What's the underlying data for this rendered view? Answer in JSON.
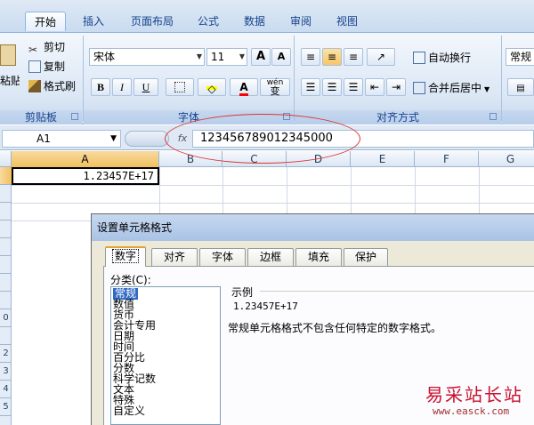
{
  "ribbon": {
    "tabs": [
      "开始",
      "插入",
      "页面布局",
      "公式",
      "数据",
      "审阅",
      "视图"
    ],
    "active_tab": "开始",
    "clipboard": {
      "paste": "粘贴",
      "cut": "剪切",
      "copy": "复制",
      "format_painter": "格式刷",
      "group": "剪贴板"
    },
    "font": {
      "name": "宋体",
      "size": "11",
      "grow": "A",
      "shrink": "A",
      "bold": "B",
      "italic": "I",
      "underline": "U",
      "font_color_letter": "A",
      "phonetic": "wén",
      "phonetic_char": "变",
      "group": "字体"
    },
    "alignment": {
      "wrap": "自动换行",
      "merge": "合并后居中",
      "group": "对齐方式"
    },
    "number": {
      "format": "常规"
    }
  },
  "formula_bar": {
    "name_box": "A1",
    "fx": "fx",
    "value": "123456789012345000"
  },
  "sheet": {
    "columns": [
      "A",
      "B",
      "C",
      "D",
      "E",
      "F",
      "G"
    ],
    "rows": [
      "",
      "",
      "",
      "",
      "",
      "",
      "",
      "",
      "0",
      "",
      "2",
      "3",
      "4",
      "5"
    ],
    "a1_display": "1.23457E+17"
  },
  "dialog": {
    "title": "设置单元格格式",
    "tabs": [
      "数字",
      "对齐",
      "字体",
      "边框",
      "填充",
      "保护"
    ],
    "active_tab": "数字",
    "category_label": "分类(C):",
    "categories": [
      "常规",
      "数值",
      "货币",
      "会计专用",
      "日期",
      "时间",
      "百分比",
      "分数",
      "科学记数",
      "文本",
      "特殊",
      "自定义"
    ],
    "selected_category": "常规",
    "sample_label": "示例",
    "sample_value": "1.23457E+17",
    "description": "常规单元格格式不包含任何特定的数字格式。"
  },
  "watermark": {
    "brand": "易采站长站",
    "url": "www.easck.com"
  },
  "colors": {
    "ribbon_blue": "#dfe9f5",
    "selection_orange": "#f1c15f",
    "annotation_red": "#dd3333"
  }
}
